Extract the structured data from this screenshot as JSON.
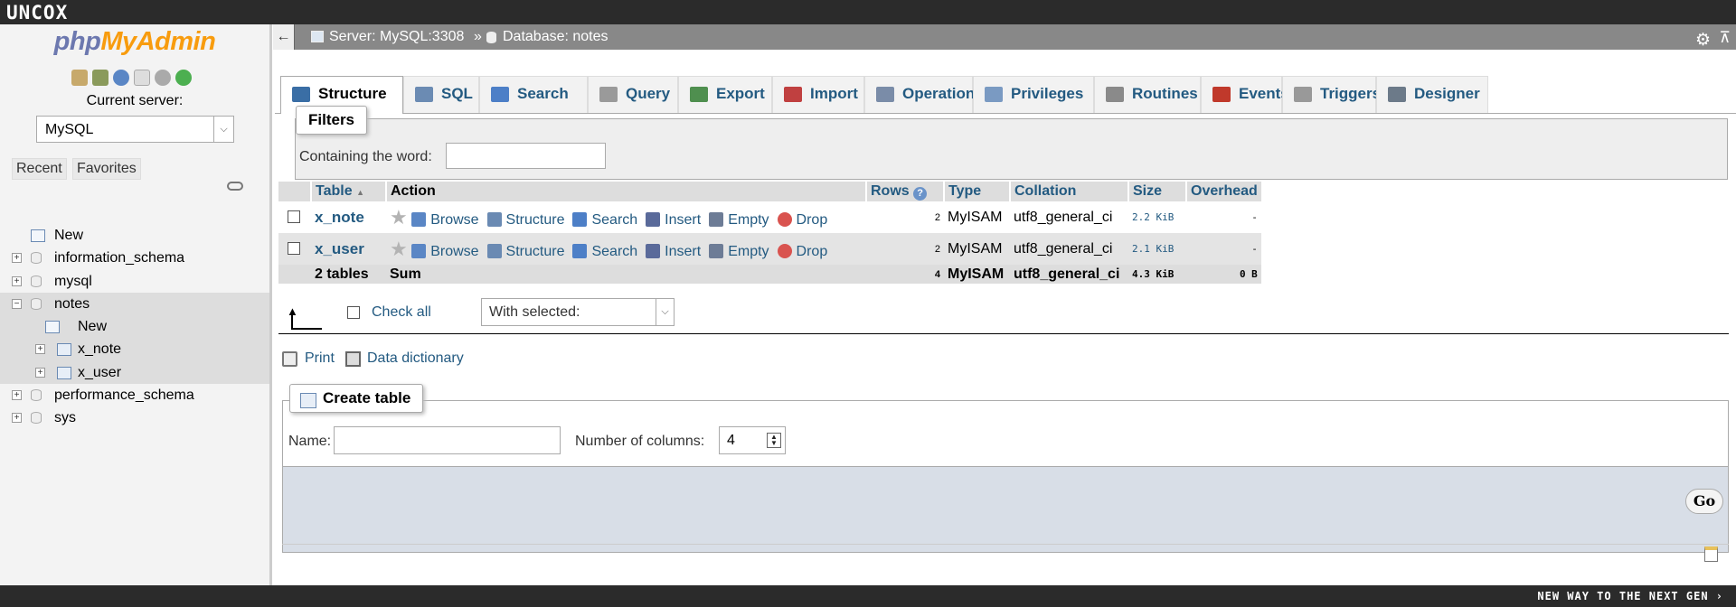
{
  "topbar": {
    "brand": "UNCOX"
  },
  "bottombar": {
    "tagline": "NEW WAY TO THE NEXT GEN ›"
  },
  "nav": {
    "logo_php": "php",
    "logo_myadmin": "MyAdmin",
    "toolbar_icons": [
      "home-icon",
      "logout-icon",
      "help-icon",
      "docs-icon",
      "settings-icon",
      "reload-icon"
    ],
    "current_server_label": "Current server:",
    "server_value": "MySQL",
    "recent": "Recent",
    "favorites": "Favorites",
    "tree": [
      {
        "label": "New",
        "type": "new",
        "level": 0
      },
      {
        "label": "information_schema",
        "type": "db",
        "level": 0
      },
      {
        "label": "mysql",
        "type": "db",
        "level": 0
      },
      {
        "label": "notes",
        "type": "db",
        "level": 0,
        "expanded": true,
        "selected": true
      },
      {
        "label": "New",
        "type": "new",
        "level": 1,
        "selected": true
      },
      {
        "label": "x_note",
        "type": "table",
        "level": 1,
        "selected": true
      },
      {
        "label": "x_user",
        "type": "table",
        "level": 1,
        "selected": true
      },
      {
        "label": "performance_schema",
        "type": "db",
        "level": 0
      },
      {
        "label": "sys",
        "type": "db",
        "level": 0
      }
    ]
  },
  "breadcrumb": {
    "server": "Server: MySQL:3308",
    "separator": "»",
    "database": "Database: notes"
  },
  "tabs": [
    {
      "label": "Structure",
      "active": true,
      "color": "#3a6ea5"
    },
    {
      "label": "SQL",
      "color": "#6b8bb3"
    },
    {
      "label": "Search",
      "color": "#4d7fc7"
    },
    {
      "label": "Query",
      "color": "#9a9a9a"
    },
    {
      "label": "Export",
      "color": "#4f8f4f"
    },
    {
      "label": "Import",
      "color": "#c04040"
    },
    {
      "label": "Operations",
      "color": "#7a8ca8"
    },
    {
      "label": "Privileges",
      "color": "#7a9ac2"
    },
    {
      "label": "Routines",
      "color": "#8a8a8a"
    },
    {
      "label": "Events",
      "color": "#c0392b"
    },
    {
      "label": "Triggers",
      "color": "#999999"
    },
    {
      "label": "Designer",
      "color": "#6c7a89"
    }
  ],
  "filters": {
    "legend": "Filters",
    "containing_label": "Containing the word:",
    "containing_value": ""
  },
  "table": {
    "headers": {
      "table": "Table",
      "action": "Action",
      "rows": "Rows",
      "type": "Type",
      "collation": "Collation",
      "size": "Size",
      "overhead": "Overhead"
    },
    "actions": [
      "Browse",
      "Structure",
      "Search",
      "Insert",
      "Empty",
      "Drop"
    ],
    "rows": [
      {
        "name": "x_note",
        "rows": "2",
        "type": "MyISAM",
        "collation": "utf8_general_ci",
        "size": "2.2 KiB",
        "overhead": "-"
      },
      {
        "name": "x_user",
        "rows": "2",
        "type": "MyISAM",
        "collation": "utf8_general_ci",
        "size": "2.1 KiB",
        "overhead": "-"
      }
    ],
    "summary": {
      "count": "2 tables",
      "label": "Sum",
      "rows": "4",
      "type": "MyISAM",
      "collation": "utf8_general_ci",
      "size": "4.3 KiB",
      "overhead": "0 B"
    }
  },
  "bulk": {
    "check_all": "Check all",
    "with_selected": "With selected:"
  },
  "links": {
    "print": "Print",
    "data_dictionary": "Data dictionary"
  },
  "create_table": {
    "legend": "Create table",
    "name_label": "Name:",
    "name_value": "",
    "columns_label": "Number of columns:",
    "columns_value": "4",
    "go": "Go"
  }
}
